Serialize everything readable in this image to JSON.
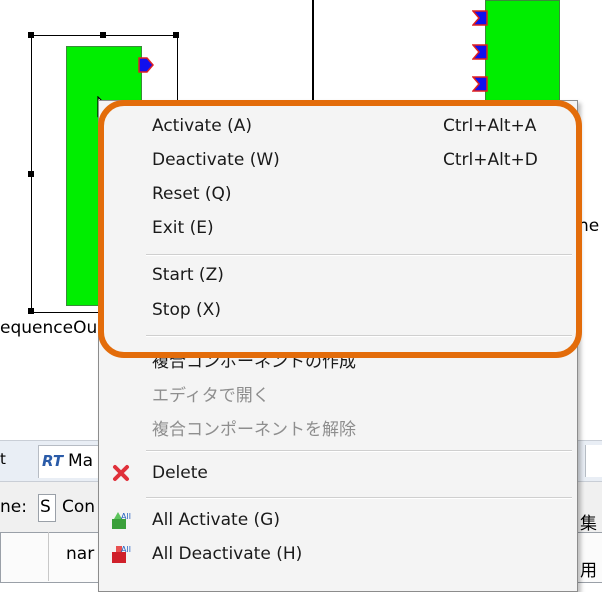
{
  "canvas": {
    "left_component_label": "equenceOu",
    "right_component_label_fragment": "ne"
  },
  "panel": {
    "tab_left_fragment": "t",
    "tab_rt_badge": "RT",
    "tab_label": "Ma",
    "row1_label": "ne:",
    "row1_field_value": "S",
    "row1_text": "Con",
    "row1_right_text": "集",
    "row2_column": "nar",
    "row2_right_text": "用"
  },
  "context_menu": {
    "items": [
      {
        "label": "Activate (A)",
        "shortcut": "Ctrl+Alt+A"
      },
      {
        "label": "Deactivate (W)",
        "shortcut": "Ctrl+Alt+D"
      },
      {
        "label": "Reset (Q)"
      },
      {
        "label": "Exit (E)"
      },
      {
        "label": "Start (Z)"
      },
      {
        "label": "Stop (X)"
      },
      {
        "label": "複合コンポーネントの作成"
      },
      {
        "label": "エディタで開く",
        "disabled": true
      },
      {
        "label": "複合コンポーネントを解除",
        "disabled": true
      },
      {
        "label": "Delete",
        "icon": "delete-x-icon"
      },
      {
        "label": "All Activate (G)",
        "icon": "all-activate-icon"
      },
      {
        "label": "All Deactivate (H)",
        "icon": "all-deactivate-icon"
      }
    ]
  },
  "colors": {
    "highlight": "#e36c0a",
    "component_fill": "#00ee00",
    "port": "#1010ee",
    "port_outline": "#e02020"
  }
}
